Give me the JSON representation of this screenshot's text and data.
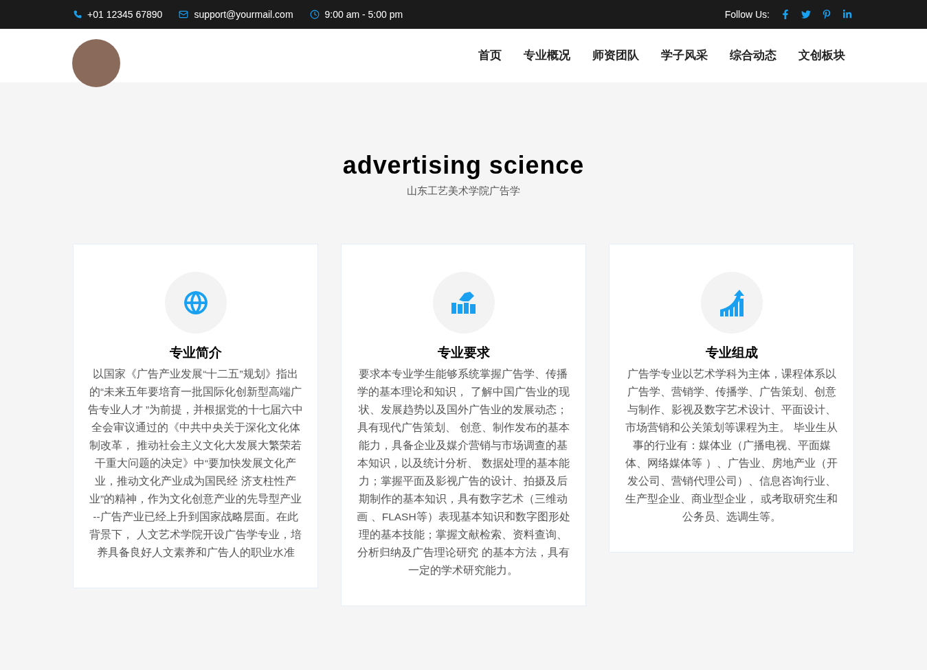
{
  "topbar": {
    "phone": "+01 12345 67890",
    "email": "support@yourmail.com",
    "hours": "9:00 am - 5:00 pm",
    "follow_label": "Follow Us:",
    "social": [
      {
        "kind": "facebook"
      },
      {
        "kind": "twitter"
      },
      {
        "kind": "pinterest"
      },
      {
        "kind": "linkedin"
      }
    ]
  },
  "nav": {
    "items": [
      {
        "label": "首页"
      },
      {
        "label": "专业概况"
      },
      {
        "label": "师资团队"
      },
      {
        "label": "学子风采"
      },
      {
        "label": "综合动态"
      },
      {
        "label": "文创板块"
      }
    ]
  },
  "section": {
    "title": "advertising science",
    "subtitle": "山东工艺美术学院广告学"
  },
  "cards": [
    {
      "kind": "globe",
      "title": "专业简介",
      "lines": [
        "以国家《广告产业发展“十二五”规划》指出",
        "的“未来五年要培育一批国际化创新型高端广",
        "告专业人才 ”为前提，并根据党的十七届六中",
        "全会审议通过的《中共中央关于深化文化体",
        "制改革， 推动社会主义文化大发展大繁荣若",
        "干重大问题的决定》中“要加快发展文化产",
        "业，推动文化产业成为国民经 济支柱性产",
        "业”的精神，作为文化创意产业的先导型产业",
        "--广告产业已经上升到国家战略层面。在此",
        "背景下， 人文艺术学院开设广告学专业，培",
        "养具备良好人文素养和广告人的职业水准"
      ]
    },
    {
      "kind": "handshake",
      "title": "专业要求",
      "lines": [
        "要求本专业学生能够系统掌握广告学、传播",
        "学的基本理论和知识， 了解中国广告业的现",
        "状、发展趋势以及国外广告业的发展动态；",
        "具有现代广告策划、 创意、制作发布的基本",
        "能力，具备企业及媒介营销与市场调查的基",
        "本知识，以及统计分析、 数据处理的基本能",
        "力；掌握平面及影视广告的设计、拍摄及后",
        "期制作的基本知识，具有数字艺术（三维动",
        "画 、FLASH等）表现基本知识和数字图形处",
        "理的基本技能；掌握文献检索、资料查询、",
        "分析归纳及广告理论研究 的基本方法，具有",
        "一定的学术研究能力。"
      ]
    },
    {
      "kind": "growth",
      "title": "专业组成",
      "lines": [
        "广告学专业以艺术学科为主体，课程体系以",
        "广告学、营销学、传播学、广告策划、创意",
        "与制作、影视及数字艺术设计、平面设计、",
        "市场营销和公关策划等课程为主。 毕业生从",
        "事的行业有：媒体业（广播电视、平面媒",
        "体、网络媒体等 ）、广告业、房地产业（开",
        "发公司、营销代理公司）、信息咨询行业、",
        "生产型企业、商业型企业， 或考取研究生和",
        "公务员、选调生等。"
      ]
    }
  ]
}
